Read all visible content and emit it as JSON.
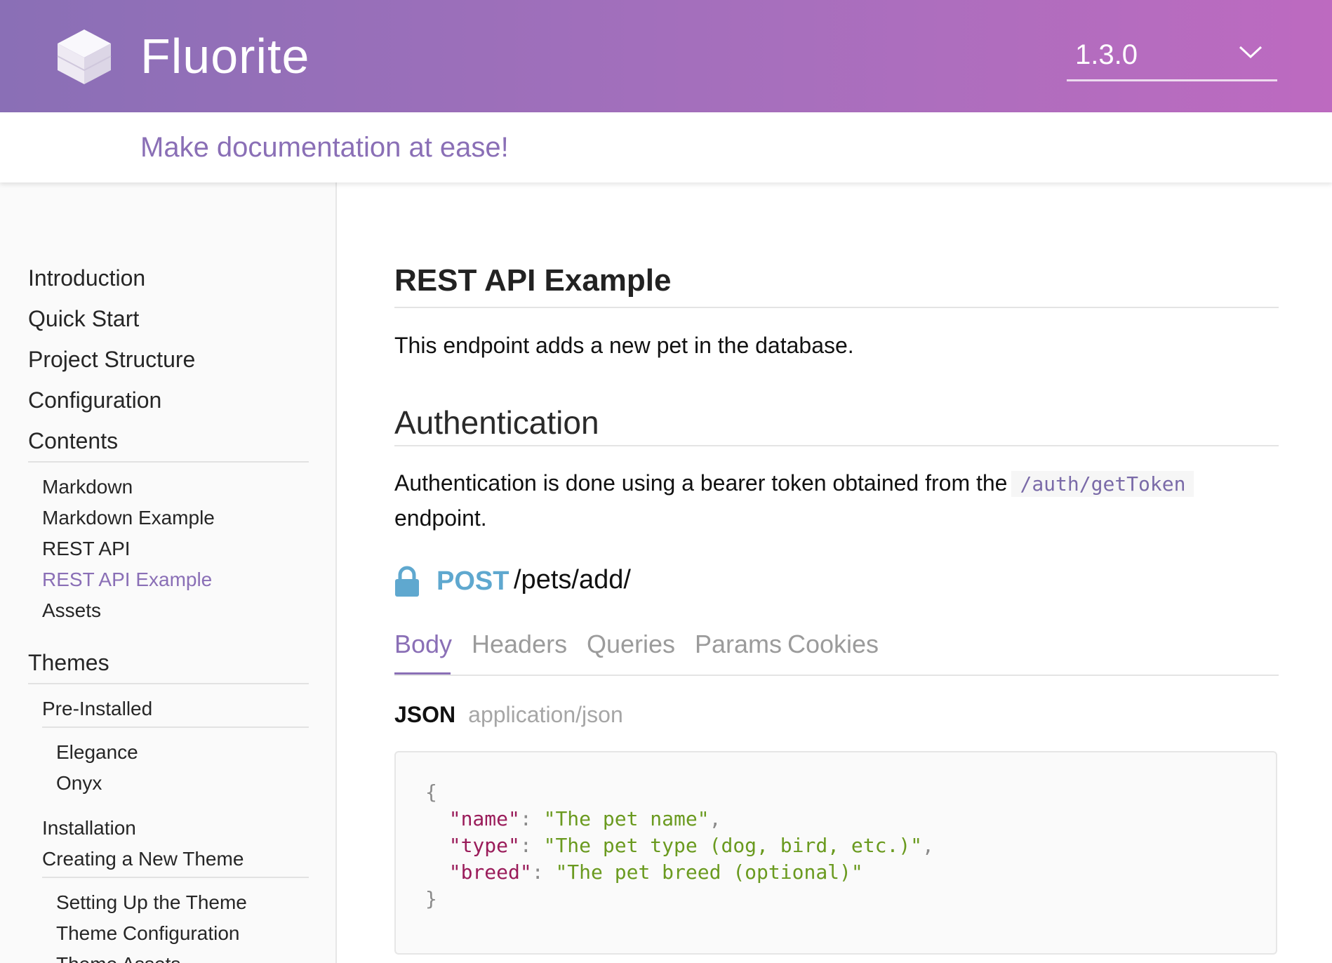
{
  "header": {
    "app_title": "Fluorite",
    "version": "1.3.0",
    "tagline": "Make documentation at ease!"
  },
  "sidebar": {
    "items": [
      {
        "label": "Introduction",
        "level": 1
      },
      {
        "label": "Quick Start",
        "level": 1
      },
      {
        "label": "Project Structure",
        "level": 1
      },
      {
        "label": "Configuration",
        "level": 1
      },
      {
        "label": "Contents",
        "level": 1
      },
      {
        "label": "Markdown",
        "level": 2
      },
      {
        "label": "Markdown Example",
        "level": 2
      },
      {
        "label": "REST API",
        "level": 2
      },
      {
        "label": "REST API Example",
        "level": 2,
        "active": true
      },
      {
        "label": "Assets",
        "level": 2
      },
      {
        "label": "Themes",
        "level": 1
      },
      {
        "label": "Pre-Installed",
        "level": 2
      },
      {
        "label": "Elegance",
        "level": 3
      },
      {
        "label": "Onyx",
        "level": 3
      },
      {
        "label": "Installation",
        "level": 2
      },
      {
        "label": "Creating a New Theme",
        "level": 2
      },
      {
        "label": "Setting Up the Theme",
        "level": 3
      },
      {
        "label": "Theme Configuration",
        "level": 3
      },
      {
        "label": "Theme Assets",
        "level": 3
      }
    ]
  },
  "main": {
    "title": "REST API Example",
    "intro": "This endpoint adds a new pet in the database.",
    "auth_heading": "Authentication",
    "auth_text_before": "Authentication is done using a bearer token obtained from the",
    "auth_code": "/auth/getToken",
    "auth_text_after": "endpoint.",
    "endpoint": {
      "method": "POST",
      "path": "/pets/add/"
    },
    "tabs": [
      {
        "label": "Body",
        "active": true
      },
      {
        "label": "Headers"
      },
      {
        "label": "Queries"
      },
      {
        "label": "Params"
      },
      {
        "label": "Cookies"
      }
    ],
    "body_format": {
      "label": "JSON",
      "mime": "application/json"
    },
    "code": {
      "open": "{",
      "close": "}",
      "entries": [
        {
          "key": "\"name\"",
          "value": "\"The pet name\"",
          "trailing": ","
        },
        {
          "key": "\"type\"",
          "value": "\"The pet type (dog, bird, etc.)\"",
          "trailing": ","
        },
        {
          "key": "\"breed\"",
          "value": "\"The pet breed (optional)\"",
          "trailing": ""
        }
      ]
    }
  },
  "colors": {
    "accent": "#8a6fb6",
    "header_gradient_start": "#8a6fb6",
    "header_gradient_end": "#bd6ac0",
    "method_post": "#5fa8cf",
    "code_key": "#9a1c5a",
    "code_string": "#6a9a1f"
  },
  "icons": {
    "logo": "cube-logo-icon",
    "version_dropdown": "chevron-down-icon",
    "endpoint_lock": "lock-icon"
  }
}
